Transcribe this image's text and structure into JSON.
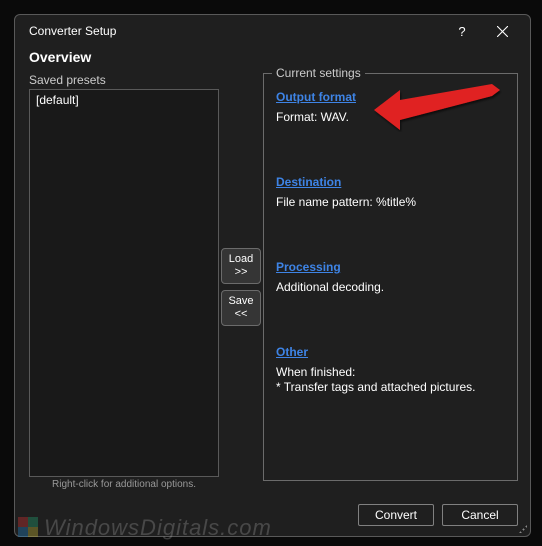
{
  "window": {
    "title": "Converter Setup",
    "help": "?",
    "close": "✕"
  },
  "header": "Overview",
  "presets": {
    "label": "Saved presets",
    "items": [
      "[default]"
    ],
    "hint": "Right-click for additional options."
  },
  "buttons": {
    "load_line1": "Load",
    "load_line2": ">>",
    "save_line1": "Save",
    "save_line2": "<<"
  },
  "settings": {
    "legend": "Current settings",
    "output": {
      "link": "Output format",
      "desc": "Format: WAV."
    },
    "destination": {
      "link": "Destination",
      "desc": "File name pattern: %title%"
    },
    "processing": {
      "link": "Processing",
      "desc": "Additional decoding."
    },
    "other": {
      "link": "Other",
      "desc": "When finished:\n* Transfer tags and attached pictures."
    }
  },
  "footer": {
    "convert": "Convert",
    "cancel": "Cancel"
  },
  "watermark": "WindowsDigitals.com"
}
